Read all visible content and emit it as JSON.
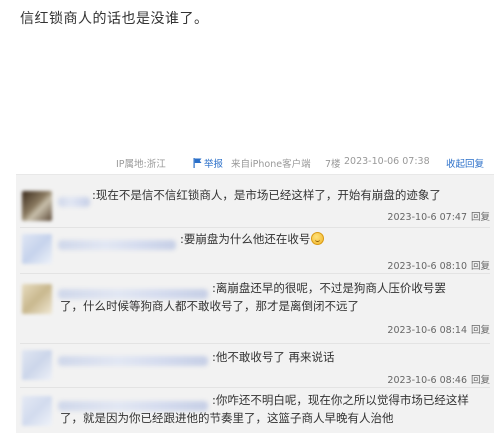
{
  "post": {
    "text": "信红锁商人的话也是没谁了。"
  },
  "meta": {
    "ip": "IP属地:浙江",
    "report": "举报",
    "client": "来自iPhone客户端",
    "floor": "7楼",
    "time": "2023-10-06 07:38",
    "collapse": "收起回复",
    "report_icon": "flag-icon"
  },
  "replies": [
    {
      "text": ":现在不是信不信红锁商人，是市场已经这样了，开始有崩盘的迹象了",
      "date": "2023-10-6 07:47",
      "reply_label": "回复"
    },
    {
      "text": ":要崩盘为什么他还在收号",
      "emoji": "smile-emoji",
      "date": "2023-10-6 08:10",
      "reply_label": "回复"
    },
    {
      "line1": ":离崩盘还早的很呢，不过是狗商人压价收号罢",
      "line2": "了，什么时候等狗商人都不敢收号了，那才是离倒闭不远了",
      "date": "2023-10-6 08:14",
      "reply_label": "回复"
    },
    {
      "text": ":他不敢收号了 再来说话",
      "date": "2023-10-6 08:46",
      "reply_label": "回复"
    },
    {
      "line1": ":你咋还不明白呢，现在你之所以觉得市场已经这样",
      "line2": "了，就是因为你已经跟进他的节奏里了，这篮子商人早晚有人治他"
    }
  ],
  "colors": {
    "link": "#2a6fc9",
    "reply_bg": "#f2f2f2",
    "meta": "#999999"
  }
}
